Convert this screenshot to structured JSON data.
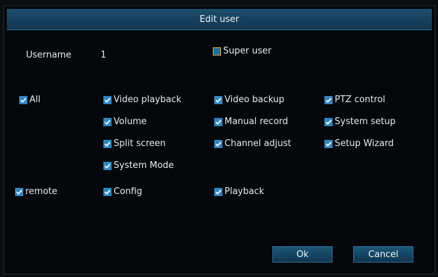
{
  "dialog": {
    "title": "Edit user"
  },
  "user": {
    "username_label": "Username",
    "username_value": "1"
  },
  "super_user": {
    "label": "Super user",
    "checked": false
  },
  "permissions": {
    "all": "All",
    "video_playback": "Video playback",
    "video_backup": "Video backup",
    "ptz_control": "PTZ control",
    "volume": "Volume",
    "manual_record": "Manual record",
    "system_setup": "System setup",
    "split_screen": "Split screen",
    "channel_adjust": "Channel adjust",
    "setup_wizard": "Setup Wizard",
    "system_mode": "System Mode"
  },
  "remote": {
    "remote": "remote",
    "config": "Config",
    "playback": "Playback"
  },
  "buttons": {
    "ok": "Ok",
    "cancel": "Cancel"
  },
  "colors": {
    "title_bar": "#154564",
    "checkbox": "#2f86c4",
    "super_box_border": "#d9b23a"
  }
}
